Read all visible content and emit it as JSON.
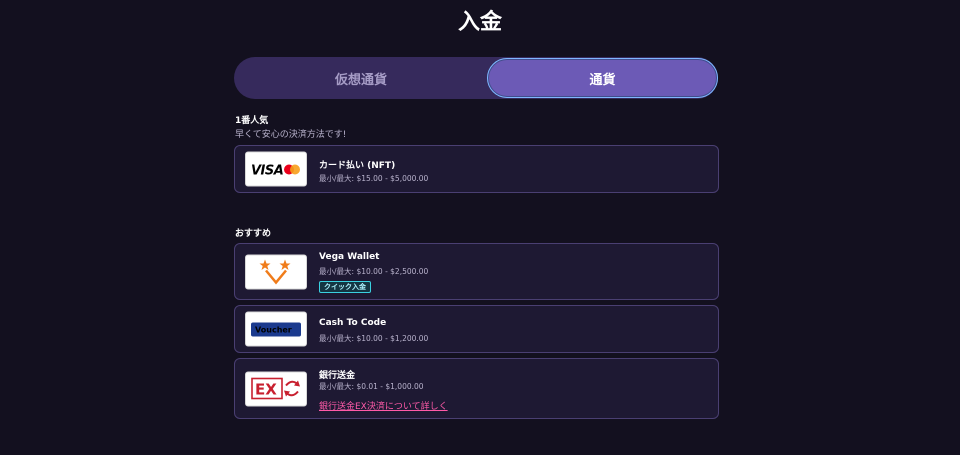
{
  "page": {
    "title": "入金"
  },
  "tabs": [
    {
      "label": "仮想通貨",
      "active": false
    },
    {
      "label": "通貨",
      "active": true
    }
  ],
  "popular": {
    "heading": "1番人気",
    "subtitle": "早くて安心の決済方法です!",
    "methods": [
      {
        "name": "カード払い (NFT)",
        "range": "最小/最大: $15.00 - $5,000.00",
        "logo": "visa-mastercard-logo"
      }
    ]
  },
  "recommended": {
    "heading": "おすすめ",
    "methods": [
      {
        "name": "Vega Wallet",
        "range": "最小/最大: $10.00 - $2,500.00",
        "badge": "クイック入金",
        "logo": "vega-wallet-logo"
      },
      {
        "name": "Cash To Code",
        "range": "最小/最大: $10.00 - $1,200.00",
        "logo": "voucher-logo",
        "logo_text": "Voucher"
      },
      {
        "name": "銀行送金",
        "range": "最小/最大: $0.01 - $1,000.00",
        "link": "銀行送金EX決済について詳しく",
        "logo": "bank-ex-logo",
        "logo_text": "EX"
      }
    ]
  },
  "colors": {
    "background": "#13101f",
    "card": "#1e1933",
    "tab_active": "#6c5ab6",
    "link": "#ff5aa8",
    "badge": "#3ad1e0"
  }
}
